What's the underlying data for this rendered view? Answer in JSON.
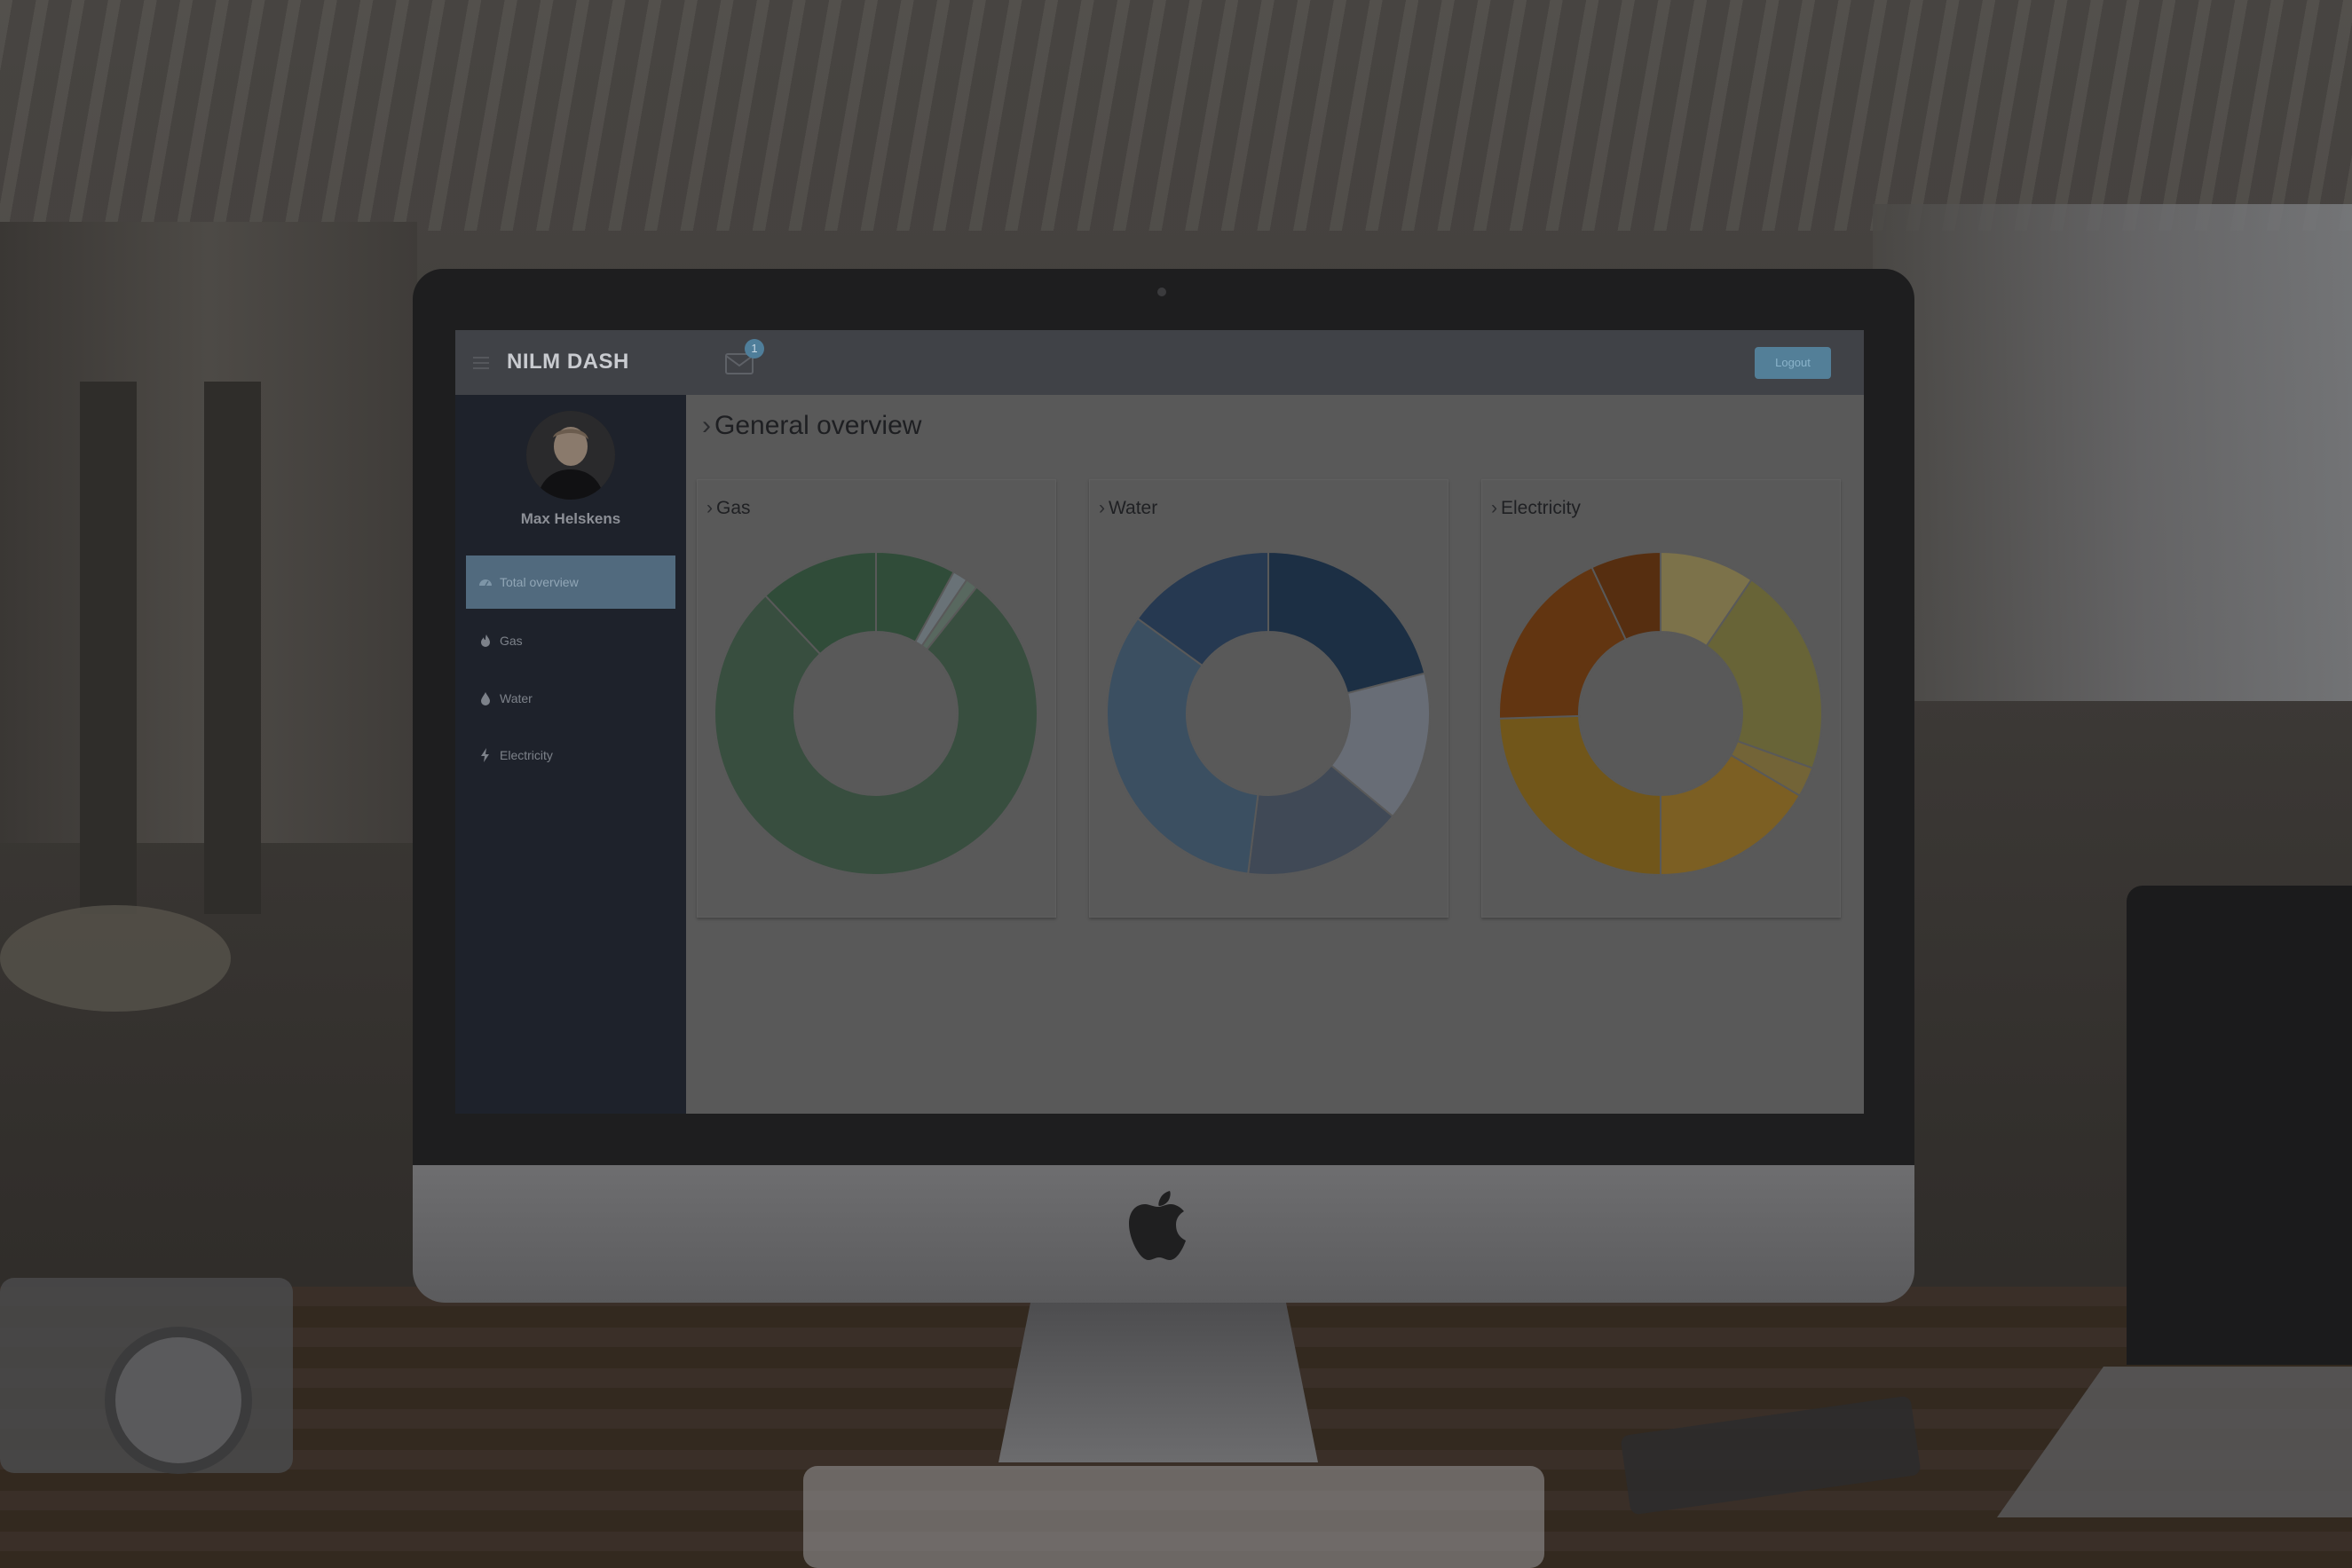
{
  "app": {
    "brand": "NILM DASH",
    "mail_badge": "1",
    "logout_label": "Logout"
  },
  "user": {
    "name": "Max Helskens"
  },
  "sidebar": {
    "items": [
      {
        "label": "Total overview",
        "icon": "dashboard-icon",
        "active": true
      },
      {
        "label": "Gas",
        "icon": "flame-icon",
        "active": false
      },
      {
        "label": "Water",
        "icon": "drop-icon",
        "active": false
      },
      {
        "label": "Electricity",
        "icon": "bolt-icon",
        "active": false
      }
    ]
  },
  "main": {
    "title": "General overview"
  },
  "colors": {
    "sidebar": "#1e222b",
    "topbar": "#404247",
    "accent": "#516a7e",
    "gas": [
      "#4e7a5c",
      "#a9b8c0",
      "#8ea79a",
      "#5a7d65"
    ],
    "water": [
      "#2d4b6e",
      "#a7afbf",
      "#67758a",
      "#5f7f9d",
      "#3d5c82"
    ],
    "electricity": [
      "#c8b878",
      "#a8a258",
      "#b9a258",
      "#c89a38",
      "#b78a2a",
      "#9e561c",
      "#8a4a1a"
    ]
  },
  "chart_data": [
    {
      "type": "pie",
      "title": "Gas",
      "values": [
        8.0,
        1.5,
        1.2,
        77.3,
        12.0
      ]
    },
    {
      "type": "pie",
      "title": "Water",
      "values": [
        21.0,
        15.0,
        16.0,
        33.0,
        15.0
      ]
    },
    {
      "type": "pie",
      "title": "Electricity",
      "values": [
        9.5,
        21.0,
        3.0,
        16.5,
        24.5,
        18.5,
        7.0
      ]
    }
  ]
}
